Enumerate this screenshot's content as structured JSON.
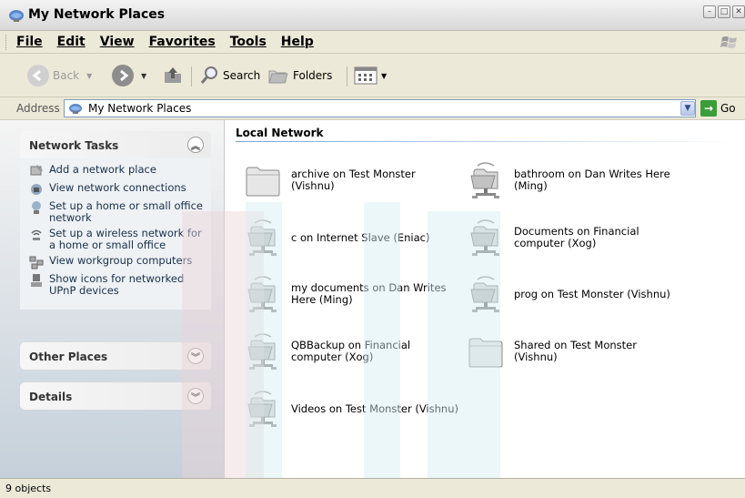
{
  "window": {
    "title": "My Network Places"
  },
  "menu": [
    "File",
    "Edit",
    "View",
    "Favorites",
    "Tools",
    "Help"
  ],
  "toolbar": {
    "back": "Back",
    "search": "Search",
    "folders": "Folders"
  },
  "address": {
    "label": "Address",
    "value": "My Network Places",
    "go": "Go"
  },
  "tasks": {
    "network": {
      "title": "Network Tasks",
      "items": [
        "Add a network place",
        "View network connections",
        "Set up a home or small office network",
        "Set up a wireless network for a home or small office",
        "View workgroup computers",
        "Show icons for networked UPnP devices"
      ]
    },
    "other": {
      "title": "Other Places"
    },
    "details": {
      "title": "Details"
    }
  },
  "content": {
    "section": "Local Network",
    "items": [
      {
        "name": "archive on Test Monster (Vishnu)",
        "icon": "folder-icon"
      },
      {
        "name": "bathroom on Dan Writes Here (Ming)",
        "icon": "network-share-icon"
      },
      {
        "name": "c on Internet Slave (Eniac)",
        "icon": "network-share-icon"
      },
      {
        "name": "Documents on Financial computer (Xog)",
        "icon": "network-share-icon"
      },
      {
        "name": "my documents on Dan Writes Here (Ming)",
        "icon": "network-share-icon"
      },
      {
        "name": "prog on Test Monster (Vishnu)",
        "icon": "network-share-icon"
      },
      {
        "name": "QBBackup on Financial computer (Xog)",
        "icon": "network-share-icon"
      },
      {
        "name": "Shared on Test Monster (Vishnu)",
        "icon": "folder-icon"
      },
      {
        "name": "Videos on Test Monster (Vishnu)",
        "icon": "network-share-icon"
      }
    ]
  },
  "status": {
    "text": "9 objects"
  }
}
